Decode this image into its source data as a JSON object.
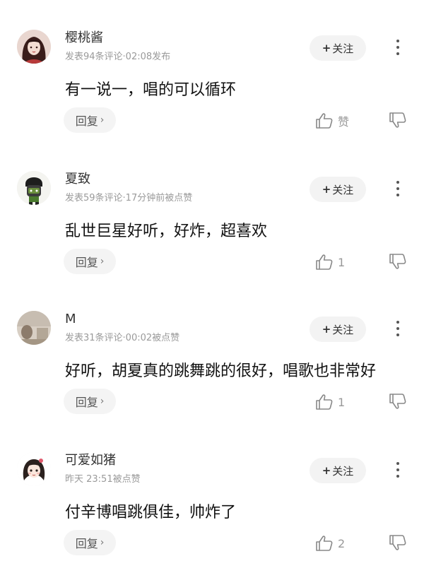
{
  "comments": [
    {
      "username": "樱桃酱",
      "meta": "发表94条评论·02:08发布",
      "content": "有一说一，唱的可以循环",
      "follow_label": "关注",
      "reply_label": "回复",
      "like_label": "赞",
      "avatar_icon": "anime-girl-avatar"
    },
    {
      "username": "夏致",
      "meta": "发表59条评论·17分钟前被点赞",
      "content": "乱世巨星好听，好炸，超喜欢",
      "follow_label": "关注",
      "reply_label": "回复",
      "like_label": "1",
      "avatar_icon": "cartoon-character-avatar"
    },
    {
      "username": "M",
      "meta": "发表31条评论·00:02被点赞",
      "content": "好听，胡夏真的跳舞跳的很好，唱歌也非常好",
      "follow_label": "关注",
      "reply_label": "回复",
      "like_label": "1",
      "avatar_icon": "photo-avatar"
    },
    {
      "username": "可爱如猪",
      "meta": "昨天 23:51被点赞",
      "content": "付辛博唱跳俱佳，帅炸了",
      "follow_label": "关注",
      "reply_label": "回复",
      "like_label": "2",
      "avatar_icon": "cartoon-girl-avatar"
    }
  ],
  "colors": {
    "button_bg": "#f3f3f3",
    "meta_text": "#9a9a9a",
    "icon_gray": "#888888"
  }
}
